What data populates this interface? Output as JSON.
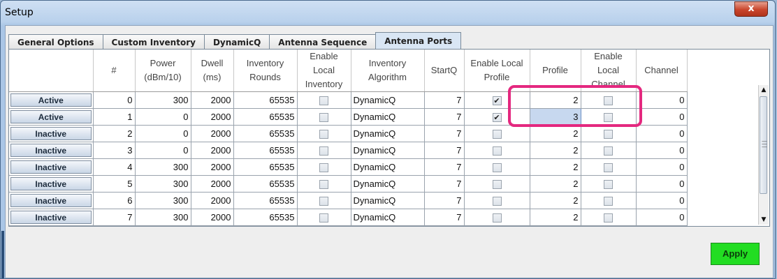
{
  "window": {
    "title": "Setup",
    "close_glyph": "x"
  },
  "tabs": [
    {
      "label": "General Options"
    },
    {
      "label": "Custom Inventory"
    },
    {
      "label": "DynamicQ"
    },
    {
      "label": "Antenna Sequence"
    },
    {
      "label": "Antenna Ports",
      "selected": true
    }
  ],
  "table": {
    "headers": [
      {
        "line1": "",
        "line2": ""
      },
      {
        "line1": "#",
        "line2": ""
      },
      {
        "line1": "Power",
        "line2": "(dBm/10)"
      },
      {
        "line1": "Dwell",
        "line2": "(ms)"
      },
      {
        "line1": "Inventory",
        "line2": "Rounds"
      },
      {
        "line1": "Enable Local",
        "line2": "Inventory"
      },
      {
        "line1": "Inventory",
        "line2": "Algorithm"
      },
      {
        "line1": "StartQ",
        "line2": ""
      },
      {
        "line1": "Enable Local",
        "line2": "Profile"
      },
      {
        "line1": "Profile",
        "line2": ""
      },
      {
        "line1": "Enable Local",
        "line2": "Channel"
      },
      {
        "line1": "Channel",
        "line2": ""
      }
    ],
    "rows": [
      {
        "status": "Active",
        "num": "0",
        "power": "300",
        "dwell": "2000",
        "rounds": "65535",
        "local_inv": false,
        "algorithm": "DynamicQ",
        "startq": "7",
        "local_profile": true,
        "profile": "2",
        "local_channel": false,
        "channel": "0"
      },
      {
        "status": "Active",
        "num": "1",
        "power": "0",
        "dwell": "2000",
        "rounds": "65535",
        "local_inv": false,
        "algorithm": "DynamicQ",
        "startq": "7",
        "local_profile": true,
        "profile": "3",
        "local_channel": false,
        "channel": "0",
        "profile_selected": true
      },
      {
        "status": "Inactive",
        "num": "2",
        "power": "0",
        "dwell": "2000",
        "rounds": "65535",
        "local_inv": false,
        "algorithm": "DynamicQ",
        "startq": "7",
        "local_profile": false,
        "profile": "2",
        "local_channel": false,
        "channel": "0"
      },
      {
        "status": "Inactive",
        "num": "3",
        "power": "0",
        "dwell": "2000",
        "rounds": "65535",
        "local_inv": false,
        "algorithm": "DynamicQ",
        "startq": "7",
        "local_profile": false,
        "profile": "2",
        "local_channel": false,
        "channel": "0"
      },
      {
        "status": "Inactive",
        "num": "4",
        "power": "300",
        "dwell": "2000",
        "rounds": "65535",
        "local_inv": false,
        "algorithm": "DynamicQ",
        "startq": "7",
        "local_profile": false,
        "profile": "2",
        "local_channel": false,
        "channel": "0"
      },
      {
        "status": "Inactive",
        "num": "5",
        "power": "300",
        "dwell": "2000",
        "rounds": "65535",
        "local_inv": false,
        "algorithm": "DynamicQ",
        "startq": "7",
        "local_profile": false,
        "profile": "2",
        "local_channel": false,
        "channel": "0"
      },
      {
        "status": "Inactive",
        "num": "6",
        "power": "300",
        "dwell": "2000",
        "rounds": "65535",
        "local_inv": false,
        "algorithm": "DynamicQ",
        "startq": "7",
        "local_profile": false,
        "profile": "2",
        "local_channel": false,
        "channel": "0"
      },
      {
        "status": "Inactive",
        "num": "7",
        "power": "300",
        "dwell": "2000",
        "rounds": "65535",
        "local_inv": false,
        "algorithm": "DynamicQ",
        "startq": "7",
        "local_profile": false,
        "profile": "2",
        "local_channel": false,
        "channel": "0"
      }
    ]
  },
  "scrollbar": {
    "up_glyph": "▲",
    "down_glyph": "▼"
  },
  "footer": {
    "apply_label": "Apply"
  },
  "colors": {
    "highlight": "#e4287f",
    "apply_bg": "#22dd22"
  },
  "icons": {
    "checkbox_checked": "checkmark-icon",
    "close": "close-icon"
  }
}
